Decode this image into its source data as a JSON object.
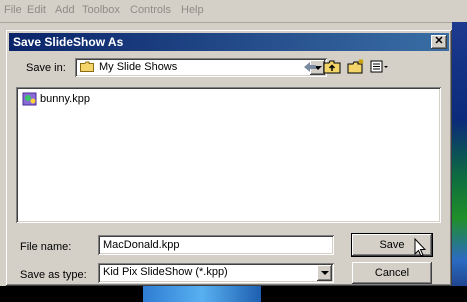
{
  "menubar": {
    "items": [
      "File",
      "Edit",
      "Add",
      "Toolbox",
      "Controls",
      "Help"
    ]
  },
  "dialog": {
    "title": "Save SlideShow As",
    "close_glyph": "✕",
    "save_in": {
      "label": "Save in:",
      "value": "My Slide Shows",
      "icon": "folder-icon"
    },
    "toolbar": [
      "back-arrow-icon",
      "up-folder-icon",
      "new-folder-icon",
      "view-menu-icon"
    ],
    "files": [
      {
        "name": "bunny.kpp",
        "icon": "kidpix-file-icon"
      }
    ],
    "file_name": {
      "label": "File name:",
      "value": "MacDonald.kpp"
    },
    "save_as_type": {
      "label": "Save as type:",
      "value": "Kid Pix SlideShow (*.kpp)"
    },
    "buttons": {
      "save": "Save",
      "cancel": "Cancel"
    }
  },
  "colors": {
    "titlebar_start": "#0a246a",
    "titlebar_end": "#3a6ea5",
    "face": "#d4d0c8"
  }
}
